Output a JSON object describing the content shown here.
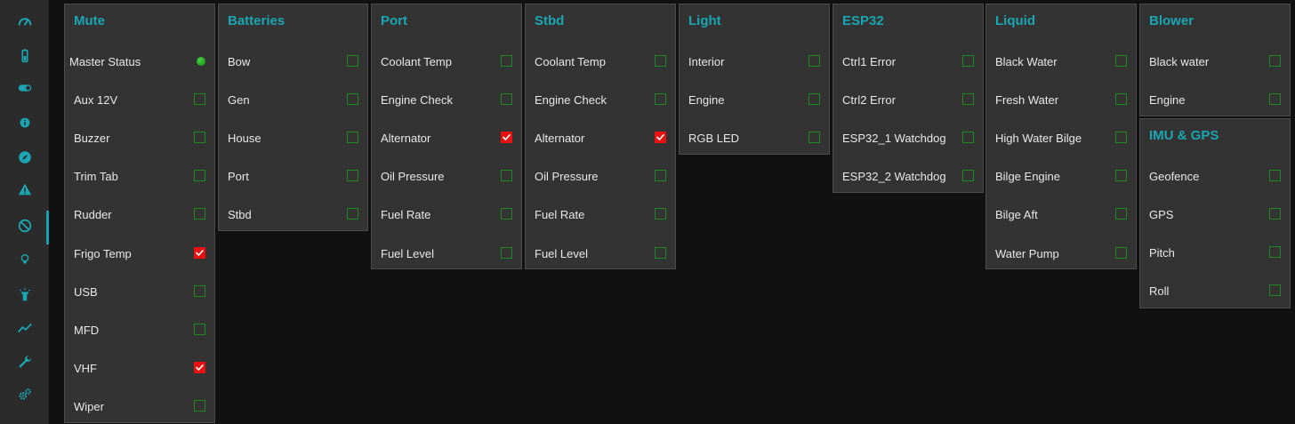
{
  "colors": {
    "accent": "#1aa7b3",
    "panel_bg": "#333333",
    "page_bg": "#111111",
    "sidebar_bg": "#2b2b2b",
    "checkbox_unchecked_border": "#1e8a1e",
    "checkbox_checked": "#e81010",
    "status_ok": "#2db52d"
  },
  "sidebar": {
    "items": [
      {
        "icon": "dashboard-gauge-icon"
      },
      {
        "icon": "battery-icon"
      },
      {
        "icon": "toggle-switch-icon"
      },
      {
        "icon": "info-circle-icon"
      },
      {
        "icon": "compass-icon"
      },
      {
        "icon": "warning-triangle-icon"
      },
      {
        "icon": "mute-ban-icon",
        "active": true
      },
      {
        "icon": "lightbulb-icon"
      },
      {
        "icon": "flashlight-icon"
      },
      {
        "icon": "chart-line-icon"
      },
      {
        "icon": "wrench-icon"
      },
      {
        "icon": "settings-gears-icon"
      }
    ]
  },
  "panels": {
    "mute": {
      "title": "Mute",
      "rows": [
        {
          "label": "Master Status",
          "state": "status"
        },
        {
          "label": "Aux 12V",
          "checked": false
        },
        {
          "label": "Buzzer",
          "checked": false
        },
        {
          "label": "Trim Tab",
          "checked": false
        },
        {
          "label": "Rudder",
          "checked": false
        },
        {
          "label": "Frigo Temp",
          "checked": true
        },
        {
          "label": "USB",
          "checked": false
        },
        {
          "label": "MFD",
          "checked": false
        },
        {
          "label": "VHF",
          "checked": true
        },
        {
          "label": "Wiper",
          "checked": false
        }
      ]
    },
    "batteries": {
      "title": "Batteries",
      "rows": [
        {
          "label": "Bow",
          "checked": false
        },
        {
          "label": "Gen",
          "checked": false
        },
        {
          "label": "House",
          "checked": false
        },
        {
          "label": "Port",
          "checked": false
        },
        {
          "label": "Stbd",
          "checked": false
        }
      ]
    },
    "port": {
      "title": "Port",
      "rows": [
        {
          "label": "Coolant Temp",
          "checked": false
        },
        {
          "label": "Engine Check",
          "checked": false
        },
        {
          "label": "Alternator",
          "checked": true
        },
        {
          "label": "Oil Pressure",
          "checked": false
        },
        {
          "label": "Fuel Rate",
          "checked": false
        },
        {
          "label": "Fuel Level",
          "checked": false
        }
      ]
    },
    "stbd": {
      "title": "Stbd",
      "rows": [
        {
          "label": "Coolant Temp",
          "checked": false
        },
        {
          "label": "Engine Check",
          "checked": false
        },
        {
          "label": "Alternator",
          "checked": true
        },
        {
          "label": "Oil Pressure",
          "checked": false
        },
        {
          "label": "Fuel Rate",
          "checked": false
        },
        {
          "label": "Fuel Level",
          "checked": false
        }
      ]
    },
    "light": {
      "title": "Light",
      "rows": [
        {
          "label": "Interior",
          "checked": false
        },
        {
          "label": "Engine",
          "checked": false
        },
        {
          "label": "RGB LED",
          "checked": false
        }
      ]
    },
    "esp32": {
      "title": "ESP32",
      "rows": [
        {
          "label": "Ctrl1 Error",
          "checked": false
        },
        {
          "label": "Ctrl2 Error",
          "checked": false
        },
        {
          "label": "ESP32_1 Watchdog",
          "checked": false
        },
        {
          "label": "ESP32_2 Watchdog",
          "checked": false
        }
      ]
    },
    "liquid": {
      "title": "Liquid",
      "rows": [
        {
          "label": "Black Water",
          "checked": false
        },
        {
          "label": "Fresh Water",
          "checked": false
        },
        {
          "label": "High Water Bilge",
          "checked": false
        },
        {
          "label": "Bilge Engine",
          "checked": false
        },
        {
          "label": "Bilge Aft",
          "checked": false
        },
        {
          "label": "Water Pump",
          "checked": false
        }
      ]
    },
    "blower": {
      "title": "Blower",
      "rows": [
        {
          "label": "Black water",
          "checked": false
        },
        {
          "label": "Engine",
          "checked": false
        }
      ]
    },
    "imu_gps": {
      "title": "IMU & GPS",
      "rows": [
        {
          "label": "Geofence",
          "checked": false
        },
        {
          "label": "GPS",
          "checked": false
        },
        {
          "label": "Pitch",
          "checked": false
        },
        {
          "label": "Roll",
          "checked": false
        }
      ]
    }
  }
}
